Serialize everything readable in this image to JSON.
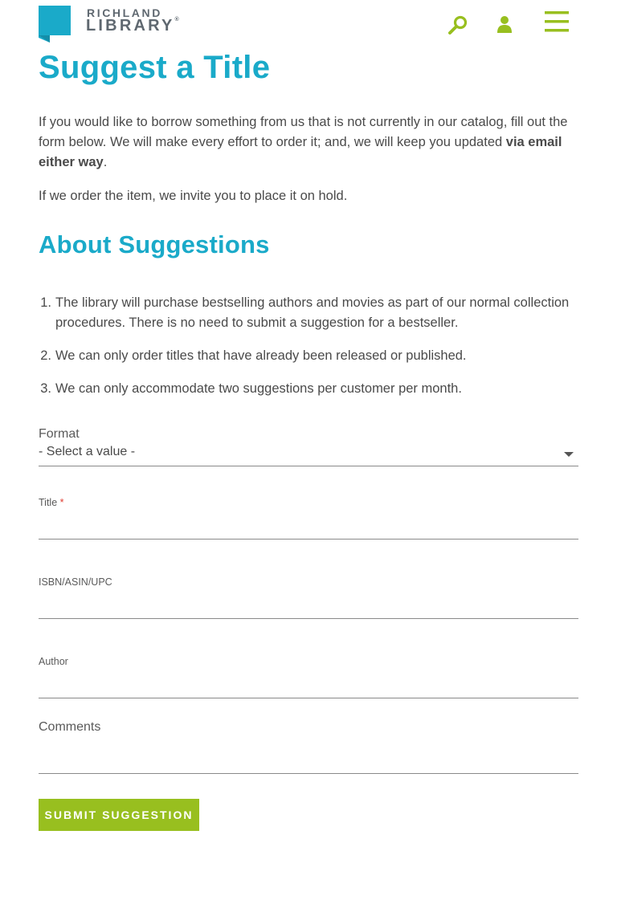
{
  "header": {
    "logo_line1": "RICHLAND",
    "logo_line2": "LIBRARY",
    "logo_reg": "®",
    "colors": {
      "brand_blue": "#1aaac9",
      "brand_green": "#98bf1f"
    },
    "icons": [
      "search-icon",
      "user-icon",
      "menu-icon"
    ]
  },
  "page": {
    "title": "Suggest a Title",
    "intro_text": "If you would like to borrow something from us that is not currently in our catalog, fill out the form below. We will make every effort to order it; and, we will keep you updated ",
    "intro_bold": "via email either way",
    "intro_end": ".",
    "hold_text": "If we order the item, we invite you to place it on hold."
  },
  "about": {
    "heading": "About Suggestions",
    "rules": [
      {
        "num": "1.",
        "text": "The library will purchase bestselling authors and movies as part of our normal collection procedures. There is no need to submit a suggestion for a bestseller."
      },
      {
        "num": "2.",
        "text": "We can only order titles that have already been released or published."
      },
      {
        "num": "3.",
        "text": "We can only accommodate two suggestions per customer per month."
      }
    ]
  },
  "form": {
    "format_label": "Format",
    "format_value": "- Select a value -",
    "title_label": "Title",
    "required_mark": "*",
    "isbn_label": "ISBN/ASIN/UPC",
    "author_label": "Author",
    "comments_label": "Comments",
    "submit_label": "SUBMIT SUGGESTION"
  }
}
